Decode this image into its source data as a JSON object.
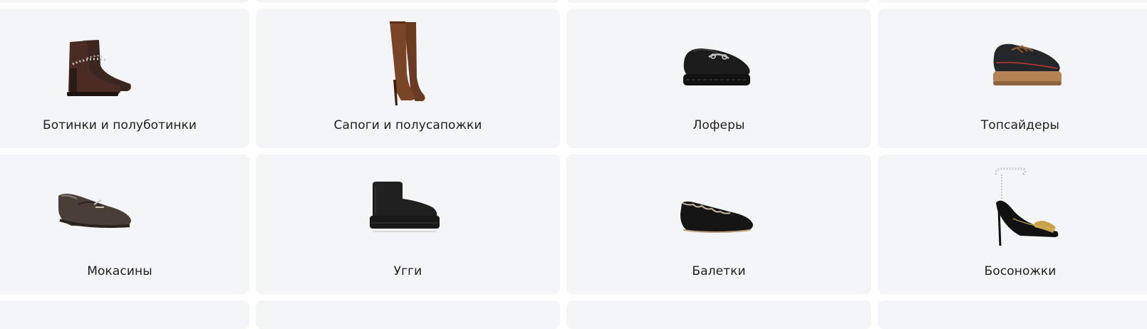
{
  "categories": [
    {
      "label": "Ботинки и полуботинки",
      "icon": "ankle-boot-icon"
    },
    {
      "label": "Сапоги и полусапожки",
      "icon": "tall-boot-icon"
    },
    {
      "label": "Лоферы",
      "icon": "loafer-icon"
    },
    {
      "label": "Топсайдеры",
      "icon": "boat-shoe-icon"
    },
    {
      "label": "Мокасины",
      "icon": "moccasin-icon"
    },
    {
      "label": "Угги",
      "icon": "ugg-boot-icon"
    },
    {
      "label": "Балетки",
      "icon": "ballet-flat-icon"
    },
    {
      "label": "Босоножки",
      "icon": "sandal-icon"
    }
  ],
  "colors": {
    "card_background": "#f4f5f7",
    "label_text": "#1e1e1e"
  }
}
